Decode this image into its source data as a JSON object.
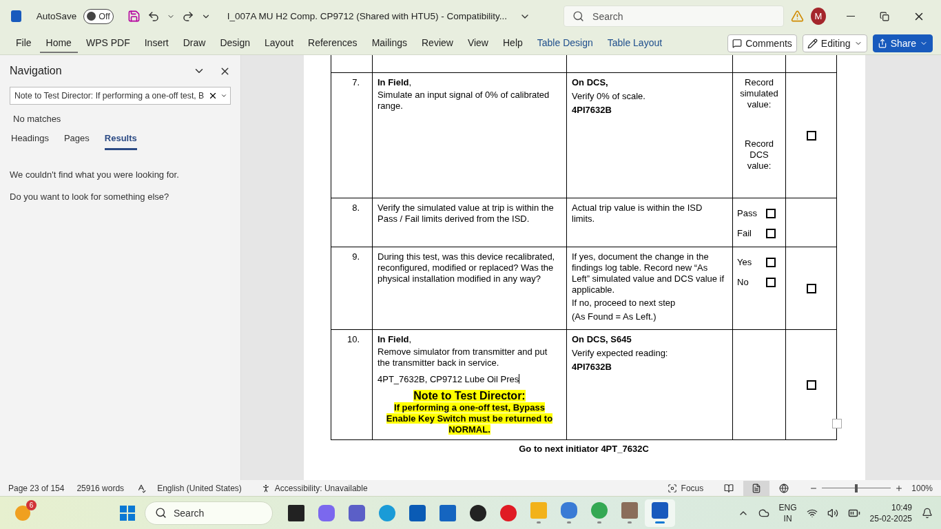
{
  "title_bar": {
    "autosave_label": "AutoSave",
    "autosave_toggle": {
      "label": "Off",
      "on": false
    },
    "document_title": "I_007A MU H2 Comp. CP9712 (Shared with HTU5)  -  Compatibility...",
    "search_placeholder": "Search",
    "avatar": "M"
  },
  "ribbon": {
    "tabs": [
      {
        "label": "File",
        "selected": false,
        "kind": "standard"
      },
      {
        "label": "Home",
        "selected": true,
        "kind": "standard"
      },
      {
        "label": "WPS PDF",
        "selected": false,
        "kind": "standard"
      },
      {
        "label": "Insert",
        "selected": false,
        "kind": "standard"
      },
      {
        "label": "Draw",
        "selected": false,
        "kind": "standard"
      },
      {
        "label": "Design",
        "selected": false,
        "kind": "standard"
      },
      {
        "label": "Layout",
        "selected": false,
        "kind": "standard"
      },
      {
        "label": "References",
        "selected": false,
        "kind": "standard"
      },
      {
        "label": "Mailings",
        "selected": false,
        "kind": "standard"
      },
      {
        "label": "Review",
        "selected": false,
        "kind": "standard"
      },
      {
        "label": "View",
        "selected": false,
        "kind": "standard"
      },
      {
        "label": "Help",
        "selected": false,
        "kind": "standard"
      },
      {
        "label": "Table Design",
        "selected": false,
        "kind": "contextual"
      },
      {
        "label": "Table Layout",
        "selected": false,
        "kind": "contextual"
      }
    ],
    "comments": "Comments",
    "editing": "Editing",
    "share": "Share"
  },
  "navigation": {
    "title": "Navigation",
    "search_value": "Note to Test Director: If performing a one-off test, B",
    "status": "No matches",
    "tabs": [
      {
        "label": "Headings",
        "selected": false
      },
      {
        "label": "Pages",
        "selected": false
      },
      {
        "label": "Results",
        "selected": true
      }
    ],
    "messages": [
      "We couldn't find what you were looking for.",
      "Do you want to look for something else?"
    ]
  },
  "document": {
    "rows": [
      {
        "number": "7.",
        "step": [
          {
            "kind": "text",
            "text": "**In Field**,"
          },
          {
            "kind": "text",
            "text": "Simulate an input signal of 0% of calibrated range."
          }
        ],
        "verify": [
          {
            "kind": "bold",
            "text": "On DCS,"
          },
          {
            "kind": "text",
            "text": "Verify 0% of scale."
          },
          {
            "kind": "bold",
            "text": "4PI7632B"
          }
        ],
        "record": [
          {
            "kind": "text",
            "text": "Record simulated value:"
          },
          {
            "kind": "text",
            "text": "Record DCS value:"
          }
        ],
        "signoff": {
          "checked": false
        }
      },
      {
        "number": "8.",
        "step": [
          {
            "kind": "text",
            "text": "Verify the simulated value at trip is within the Pass / Fail limits derived from the ISD."
          }
        ],
        "verify": [
          {
            "kind": "text",
            "text": "Actual trip value is within the ISD limits."
          }
        ],
        "record": [
          {
            "kind": "option",
            "text": "Pass",
            "checked": false
          },
          {
            "kind": "option",
            "text": "Fail",
            "checked": false
          }
        ]
      },
      {
        "number": "9.",
        "step": [
          {
            "kind": "text",
            "text": "During this test, was this device recalibrated, reconfigured, modified or replaced? Was the physical installation modified in any way?"
          }
        ],
        "verify": [
          {
            "kind": "text",
            "text": "If yes, document the change in the findings log table. Record new “As Left” simulated value and DCS value if applicable."
          },
          {
            "kind": "text",
            "text": "If no, proceed to next step"
          },
          {
            "kind": "text",
            "text": "(As Found = As Left.)"
          }
        ],
        "record": [
          {
            "kind": "option",
            "text": "Yes",
            "checked": false
          },
          {
            "kind": "option",
            "text": "No",
            "checked": false
          }
        ],
        "signoff": {
          "checked": false
        }
      },
      {
        "number": "10.",
        "step": [
          {
            "kind": "text",
            "text": "**In Field**,"
          },
          {
            "kind": "text",
            "text": "Remove simulator from transmitter and put the transmitter back in service."
          },
          {
            "kind": "typing",
            "text": "4PT_7632B, CP9712 Lube Oil Pres"
          },
          {
            "kind": "note_title",
            "text": "Note to Test Director:"
          },
          {
            "kind": "note_body",
            "text": "If performing a one-off test, Bypass Enable Key Switch must be returned to NORMAL."
          }
        ],
        "verify": [
          {
            "kind": "bold",
            "text": "On DCS, S645"
          },
          {
            "kind": "text",
            "text": "Verify expected reading:"
          },
          {
            "kind": "bold",
            "text": "4PI7632B"
          }
        ],
        "signoff": {
          "checked": false
        }
      }
    ],
    "footer_text": "Go to next initiator 4PT_7632C"
  },
  "status_bar": {
    "page": "Page 23 of 154",
    "words": "25916 words",
    "language": "English (United States)",
    "accessibility": "Accessibility: Unavailable",
    "focus": "Focus",
    "views": [
      {
        "kind": "read",
        "selected": false
      },
      {
        "kind": "print",
        "selected": true
      },
      {
        "kind": "web",
        "selected": false
      }
    ],
    "zoom": {
      "level": 0.5
    },
    "zoom_label": "100%"
  },
  "taskbar": {
    "weather_badge": "6",
    "search_placeholder": "Search",
    "apps": [
      {
        "kind": "desktop",
        "running": false,
        "active": false
      },
      {
        "kind": "copilot",
        "running": false,
        "active": false
      },
      {
        "kind": "teams",
        "running": false,
        "active": false
      },
      {
        "kind": "edge",
        "running": false,
        "active": false
      },
      {
        "kind": "store",
        "running": false,
        "active": false
      },
      {
        "kind": "power",
        "running": false,
        "active": false
      },
      {
        "kind": "dell",
        "running": false,
        "active": false
      },
      {
        "kind": "opera",
        "running": false,
        "active": false
      },
      {
        "kind": "folder",
        "running": true,
        "active": false
      },
      {
        "kind": "birds",
        "running": true,
        "active": false
      },
      {
        "kind": "chrome",
        "running": true,
        "active": false
      },
      {
        "kind": "contact",
        "running": true,
        "active": false
      },
      {
        "kind": "word",
        "running": true,
        "active": true
      }
    ],
    "language": "ENG",
    "region": "IN",
    "time": "10:49",
    "date": "25-02-2025"
  }
}
